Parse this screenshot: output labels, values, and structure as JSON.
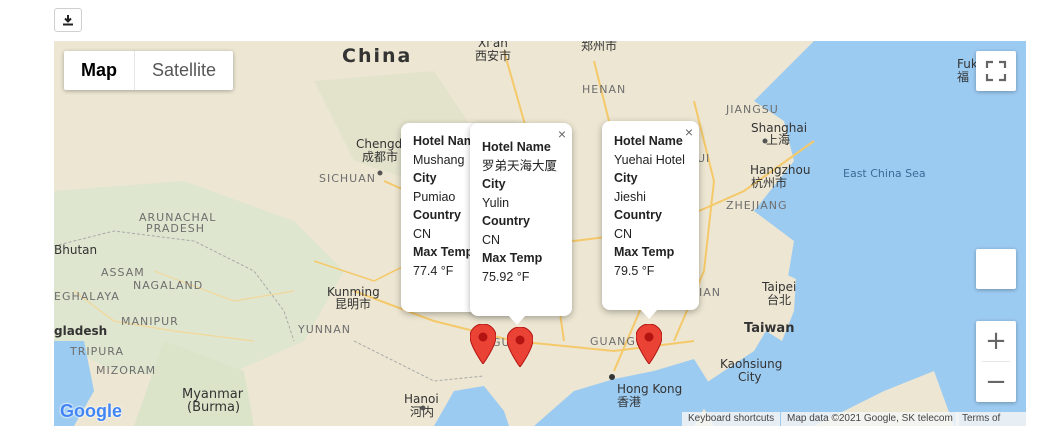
{
  "toolbar": {
    "download_icon": "download-icon"
  },
  "map_type": {
    "map_label": "Map",
    "satellite_label": "Satellite",
    "active": "Map"
  },
  "labels": {
    "china": "China",
    "xian": "Xi'an",
    "xian_cn": "西安市",
    "zhengzhou_cn": "郑州市",
    "henan": "HENAN",
    "jiangsu": "JIANGSU",
    "shanghai": "Shanghai",
    "shanghai_cn": "上海",
    "hangzhou": "Hangzhou",
    "hangzhou_cn": "杭州市",
    "zhejiang": "ZHEJIANG",
    "east_china_sea": "East China Sea",
    "chengdu": "Chengd",
    "chengdu_cn": "成都市",
    "sichuan": "SICHUAN",
    "arunachal": "ARUNACHAL",
    "pradesh": "PRADESH",
    "bhutan": "Bhutan",
    "assam": "ASSAM",
    "nagaland": "NAGALAND",
    "meghalaya": "EGHALAYA",
    "manipur": "MANIPUR",
    "bangladesh": "gladesh",
    "tripura": "TRIPURA",
    "mizoram": "MIZORAM",
    "kunming": "Kunming",
    "kunming_cn": "昆明市",
    "yunnan": "YUNNAN",
    "myanmar": "Myanmar",
    "burma": "(Burma)",
    "hanoi": "Hanoi",
    "hanoi_cn": "河内",
    "guangxi": "GU    XI",
    "guangdong": "GUANGD   G",
    "hong_kong": "Hong Kong",
    "hong_kong_cn": "香港",
    "taipei": "Taipei",
    "taipei_cn": "台北",
    "taiwan": "Taiwan",
    "kaohsiung": "Kaohsiung",
    "city_suffix": "City",
    "fuk": "Fuk",
    "fuk_cn": "福",
    "uan": "IAN",
    "ui": "UI"
  },
  "infowindows": [
    {
      "hotel_label": "Hotel Name",
      "hotel": "Mushang",
      "city_label": "City",
      "city": "Pumiao",
      "country_label": "Country",
      "country": "CN",
      "temp_label": "Max Temp",
      "temp": "77.4 °F"
    },
    {
      "hotel_label": "Hotel Name",
      "hotel": "罗弟天海大厦",
      "city_label": "City",
      "city": "Yulin",
      "country_label": "Country",
      "country": "CN",
      "temp_label": "Max Temp",
      "temp": "75.92 °F",
      "close": "×"
    },
    {
      "hotel_label": "Hotel Name",
      "hotel": "Yuehai Hotel",
      "city_label": "City",
      "city": "Jieshi",
      "country_label": "Country",
      "country": "CN",
      "temp_label": "Max Temp",
      "temp": "79.5 °F",
      "close": "×"
    }
  ],
  "markers": {
    "color": "#ea4335",
    "count": 3
  },
  "controls": {
    "zoom_in": "+",
    "zoom_out": "−",
    "fullscreen_icon": "fullscreen-icon"
  },
  "attribution": {
    "google": "Google",
    "shortcuts": "Keyboard shortcuts",
    "data": "Map data ©2021 Google, SK telecom",
    "terms": "Terms of Use"
  },
  "colors": {
    "land": "#ece6d2",
    "water": "#9ccbf2",
    "road": "#f5c96a"
  }
}
